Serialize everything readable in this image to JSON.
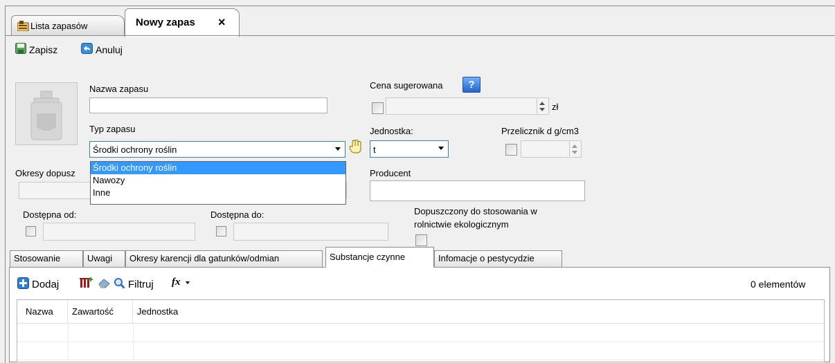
{
  "tabs": [
    {
      "label": "Lista zapasów",
      "icon": "grid-table-icon"
    },
    {
      "label": "Nowy zapas",
      "close": "×"
    }
  ],
  "toolbar": {
    "save_label": "Zapisz",
    "cancel_label": "Anuluj"
  },
  "form": {
    "name_label": "Nazwa zapasu",
    "name_value": "",
    "type_label": "Typ zapasu",
    "type_selected": "Środki ochrony roślin",
    "type_options": [
      "Środki ochrony roślin",
      "Nawozy",
      "Inne"
    ],
    "periods_label": "Okresy dopusz",
    "price_label": "Cena sugerowana",
    "price_help": "?",
    "price_unit": "zł",
    "unit_label": "Jednostka:",
    "unit_value": "t",
    "density_label": "Przelicznik d g/cm3",
    "producer_label": "Producent",
    "available_from_label": "Dostępna od:",
    "available_to_label": "Dostępna do:",
    "eco_label_line1": "Dopuszczony do stosowania w",
    "eco_label_line2": "rolnictwie ekologicznym"
  },
  "subtabs": [
    {
      "label": "Stosowanie"
    },
    {
      "label": "Uwagi"
    },
    {
      "label": "Okresy karencji dla gatunków/odmian"
    },
    {
      "label": "Substancje czynne",
      "active": true
    },
    {
      "label": "Infomacje o pestycydzie"
    }
  ],
  "grid_toolbar": {
    "add_label": "Dodaj",
    "filter_label": "Filtruj",
    "fx_label": "fx",
    "count_label": "0 elementów"
  },
  "grid": {
    "columns": [
      "Nazwa",
      "Zawartość",
      "Jednostka"
    ]
  },
  "colors": {
    "selection": "#3399ff",
    "accent": "#3c7fb1"
  }
}
